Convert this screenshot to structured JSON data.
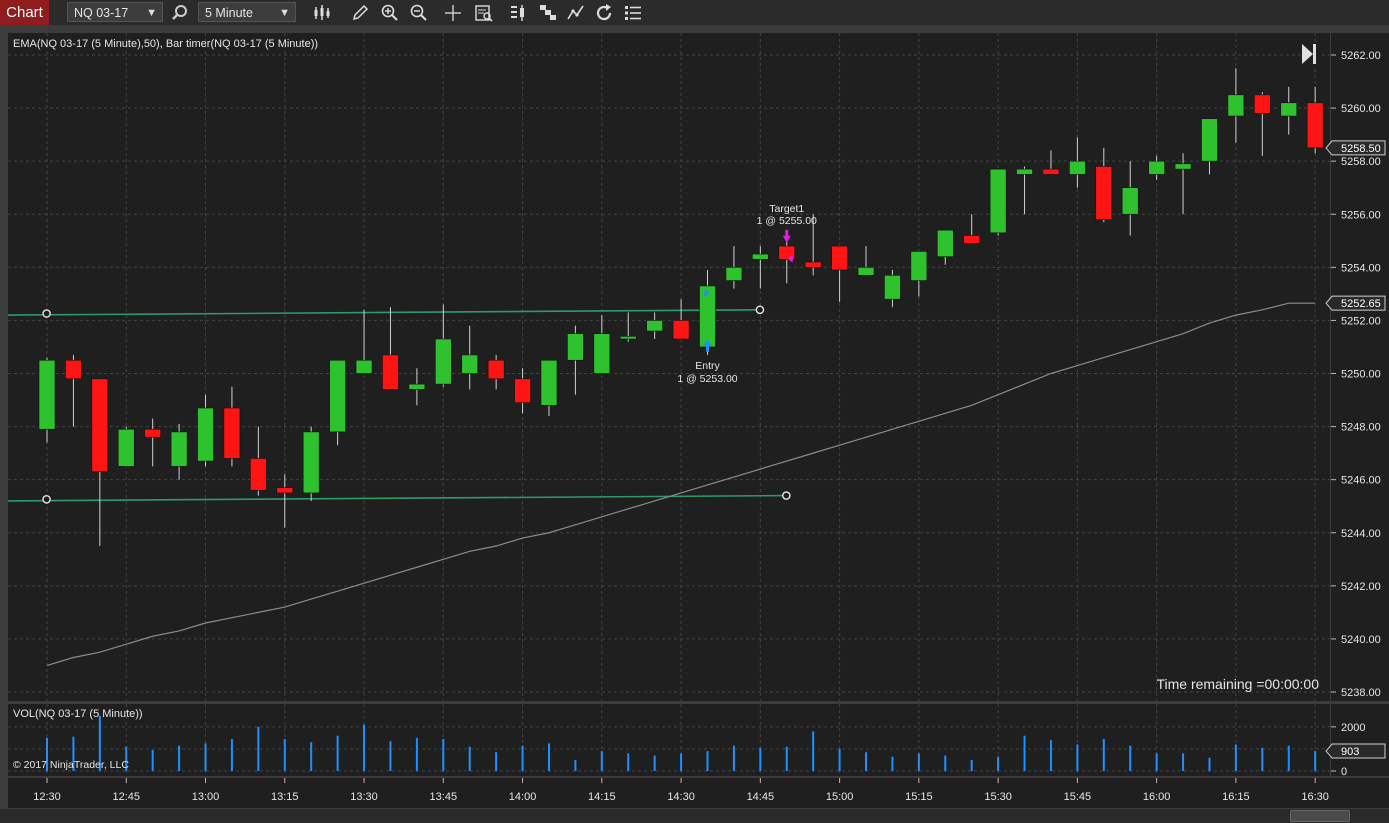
{
  "toolbar": {
    "chart_tab": "Chart",
    "instrument": "NQ 03-17",
    "interval": "5 Minute",
    "tool_icons": [
      "search-icon",
      "bar-style-icon",
      "pencil-icon",
      "zoom-in-icon",
      "zoom-out-icon",
      "crosshair-icon",
      "data-box-icon",
      "indicators-icon",
      "strategies-icon",
      "drawing-tools-icon",
      "refresh-icon",
      "properties-icon"
    ]
  },
  "price_panel": {
    "label": "EMA(NQ 03-17 (5 Minute),50), Bar timer(NQ 03-17 (5 Minute))",
    "time_remaining": "Time remaining =00:00:00",
    "current_price_label": "5258.50",
    "ema_label": "5252.65",
    "y_ticks": [
      "5262.00",
      "5260.00",
      "5258.00",
      "5256.00",
      "5254.00",
      "5252.00",
      "5250.00",
      "5248.00",
      "5246.00",
      "5244.00",
      "5242.00",
      "5240.00",
      "5238.00"
    ]
  },
  "volume_panel": {
    "label": "VOL(NQ 03-17 (5 Minute))",
    "copyright": "© 2017 NinjaTrader, LLC",
    "current_volume_label": "903",
    "y_ticks": [
      "2000",
      "1000",
      "0"
    ]
  },
  "x_axis": {
    "ticks": [
      "12:30",
      "12:45",
      "13:00",
      "13:15",
      "13:30",
      "13:45",
      "14:00",
      "14:15",
      "14:30",
      "14:45",
      "15:00",
      "15:15",
      "15:30",
      "15:45",
      "16:00",
      "16:15",
      "16:30"
    ]
  },
  "markers": {
    "entry_name": "Entry",
    "entry_detail": "1 @ 5253.00",
    "target_name": "Target1",
    "target_detail": "1 @ 5255.00"
  },
  "colors": {
    "up": "#2ec22e",
    "down": "#ff1414",
    "volume": "#1e90ff",
    "ema": "#8c8c8c",
    "hline": "#2e9a6a",
    "entry": "#1e90ff",
    "target": "#e020e0"
  },
  "chart_data": [
    {
      "type": "candlestick",
      "title": "EMA(NQ 03-17 (5 Minute),50), Bar timer(NQ 03-17 (5 Minute))",
      "x": [
        "12:30",
        "12:35",
        "12:40",
        "12:45",
        "12:50",
        "12:55",
        "13:00",
        "13:05",
        "13:10",
        "13:15",
        "13:20",
        "13:25",
        "13:30",
        "13:35",
        "13:40",
        "13:45",
        "13:50",
        "13:55",
        "14:00",
        "14:05",
        "14:10",
        "14:15",
        "14:20",
        "14:25",
        "14:30",
        "14:35",
        "14:40",
        "14:45",
        "14:50",
        "14:55",
        "15:00",
        "15:05",
        "15:10",
        "15:15",
        "15:20",
        "15:25",
        "15:30",
        "15:35",
        "15:40",
        "15:45",
        "15:50",
        "15:55",
        "16:00",
        "16:05",
        "16:10",
        "16:15",
        "16:20",
        "16:25",
        "16:30"
      ],
      "open": [
        5247.9,
        5250.5,
        5249.8,
        5246.5,
        5247.9,
        5246.5,
        5246.7,
        5248.7,
        5246.8,
        5245.7,
        5245.5,
        5247.8,
        5250.0,
        5250.7,
        5249.4,
        5249.6,
        5250.0,
        5250.5,
        5249.8,
        5248.8,
        5250.5,
        5250.0,
        5251.3,
        5251.6,
        5252.0,
        5251.0,
        5253.5,
        5254.3,
        5254.8,
        5254.2,
        5254.8,
        5253.7,
        5252.8,
        5253.5,
        5254.4,
        5255.2,
        5255.3,
        5257.5,
        5257.7,
        5257.5,
        5257.8,
        5256.0,
        5257.5,
        5257.7,
        5258.0,
        5259.7,
        5260.5,
        5259.7,
        5260.2
      ],
      "high": [
        5250.6,
        5250.7,
        5249.8,
        5248.0,
        5248.3,
        5248.1,
        5249.2,
        5249.5,
        5248.0,
        5246.2,
        5248.0,
        5250.2,
        5252.4,
        5252.5,
        5250.2,
        5252.6,
        5251.8,
        5250.7,
        5250.2,
        5249.5,
        5251.8,
        5252.2,
        5252.3,
        5252.3,
        5252.8,
        5253.9,
        5254.8,
        5254.8,
        5255.2,
        5256.0,
        5254.8,
        5254.8,
        5253.9,
        5254.6,
        5255.2,
        5256.0,
        5257.2,
        5257.8,
        5258.4,
        5258.9,
        5258.5,
        5258.0,
        5258.2,
        5258.3,
        5259.5,
        5261.5,
        5260.6,
        5260.8,
        5260.8
      ],
      "low": [
        5247.4,
        5248.0,
        5243.5,
        5246.5,
        5246.5,
        5246.0,
        5246.5,
        5246.5,
        5245.4,
        5244.2,
        5245.2,
        5247.3,
        5250.0,
        5249.4,
        5248.8,
        5249.5,
        5249.4,
        5249.4,
        5248.5,
        5248.4,
        5249.2,
        5251.1,
        5251.2,
        5251.3,
        5251.4,
        5250.7,
        5253.2,
        5253.2,
        5253.4,
        5253.7,
        5252.7,
        5253.7,
        5252.5,
        5252.9,
        5254.1,
        5255.1,
        5255.2,
        5256.0,
        5257.5,
        5257.0,
        5255.7,
        5255.2,
        5257.3,
        5256.0,
        5257.5,
        5258.7,
        5258.2,
        5259.0,
        5258.3
      ],
      "close": [
        5250.5,
        5249.8,
        5246.3,
        5247.9,
        5247.6,
        5247.8,
        5248.7,
        5246.8,
        5245.6,
        5245.5,
        5247.8,
        5250.5,
        5250.5,
        5249.4,
        5249.6,
        5251.3,
        5250.7,
        5249.8,
        5248.9,
        5250.5,
        5251.5,
        5251.5,
        5251.4,
        5252.0,
        5251.3,
        5253.3,
        5254.0,
        5254.5,
        5254.3,
        5254.0,
        5253.9,
        5254.0,
        5253.7,
        5254.6,
        5255.4,
        5254.9,
        5257.7,
        5257.7,
        5257.5,
        5258.0,
        5255.8,
        5257.0,
        5258.0,
        5257.9,
        5259.6,
        5260.5,
        5259.8,
        5260.2,
        5258.5
      ],
      "ema": [
        5239.0,
        5239.3,
        5239.5,
        5239.8,
        5240.1,
        5240.3,
        5240.6,
        5240.8,
        5241.0,
        5241.2,
        5241.5,
        5241.8,
        5242.1,
        5242.4,
        5242.7,
        5243.0,
        5243.3,
        5243.5,
        5243.8,
        5244.0,
        5244.3,
        5244.6,
        5244.9,
        5245.2,
        5245.5,
        5245.8,
        5246.1,
        5246.4,
        5246.7,
        5247.0,
        5247.3,
        5247.6,
        5247.9,
        5248.2,
        5248.5,
        5248.8,
        5249.2,
        5249.6,
        5250.0,
        5250.3,
        5250.6,
        5250.9,
        5251.2,
        5251.5,
        5251.9,
        5252.2,
        5252.4,
        5252.65,
        5252.65
      ],
      "ylim": [
        5237.5,
        5262.5
      ],
      "horizontal_lines": [
        {
          "from": "12:25",
          "to": "14:40",
          "y_start": 5252.2,
          "y_end": 5252.4
        },
        {
          "from": "12:25",
          "to": "14:45",
          "y_start": 5245.2,
          "y_end": 5245.4
        }
      ],
      "entry": {
        "time": "14:35",
        "price": 5253.0,
        "label": "Entry",
        "detail": "1 @ 5253.00"
      },
      "target": {
        "time": "14:50",
        "price": 5255.0,
        "label": "Target1",
        "detail": "1 @ 5255.00"
      },
      "last_price": 5258.5,
      "ema_last": 5252.65,
      "grid": true
    },
    {
      "type": "bar",
      "title": "VOL(NQ 03-17 (5 Minute))",
      "x": [
        "12:30",
        "12:35",
        "12:40",
        "12:45",
        "12:50",
        "12:55",
        "13:00",
        "13:05",
        "13:10",
        "13:15",
        "13:20",
        "13:25",
        "13:30",
        "13:35",
        "13:40",
        "13:45",
        "13:50",
        "13:55",
        "14:00",
        "14:05",
        "14:10",
        "14:15",
        "14:20",
        "14:25",
        "14:30",
        "14:35",
        "14:40",
        "14:45",
        "14:50",
        "14:55",
        "15:00",
        "15:05",
        "15:10",
        "15:15",
        "15:20",
        "15:25",
        "15:30",
        "15:35",
        "15:40",
        "15:45",
        "15:50",
        "15:55",
        "16:00",
        "16:05",
        "16:10",
        "16:15",
        "16:20",
        "16:25",
        "16:30"
      ],
      "values": [
        1500,
        1550,
        2500,
        1100,
        950,
        1150,
        1250,
        1450,
        2000,
        1450,
        1300,
        1600,
        2100,
        1350,
        1500,
        1450,
        1100,
        850,
        1150,
        1250,
        500,
        900,
        800,
        700,
        800,
        900,
        1150,
        1050,
        1100,
        1800,
        1000,
        850,
        650,
        800,
        700,
        500,
        650,
        1600,
        1400,
        1200,
        1450,
        1150,
        800,
        800,
        600,
        1200,
        1050,
        1150,
        903
      ],
      "ylim": [
        0,
        2400
      ],
      "y_ticks": [
        0,
        1000,
        2000
      ],
      "grid": true
    }
  ]
}
